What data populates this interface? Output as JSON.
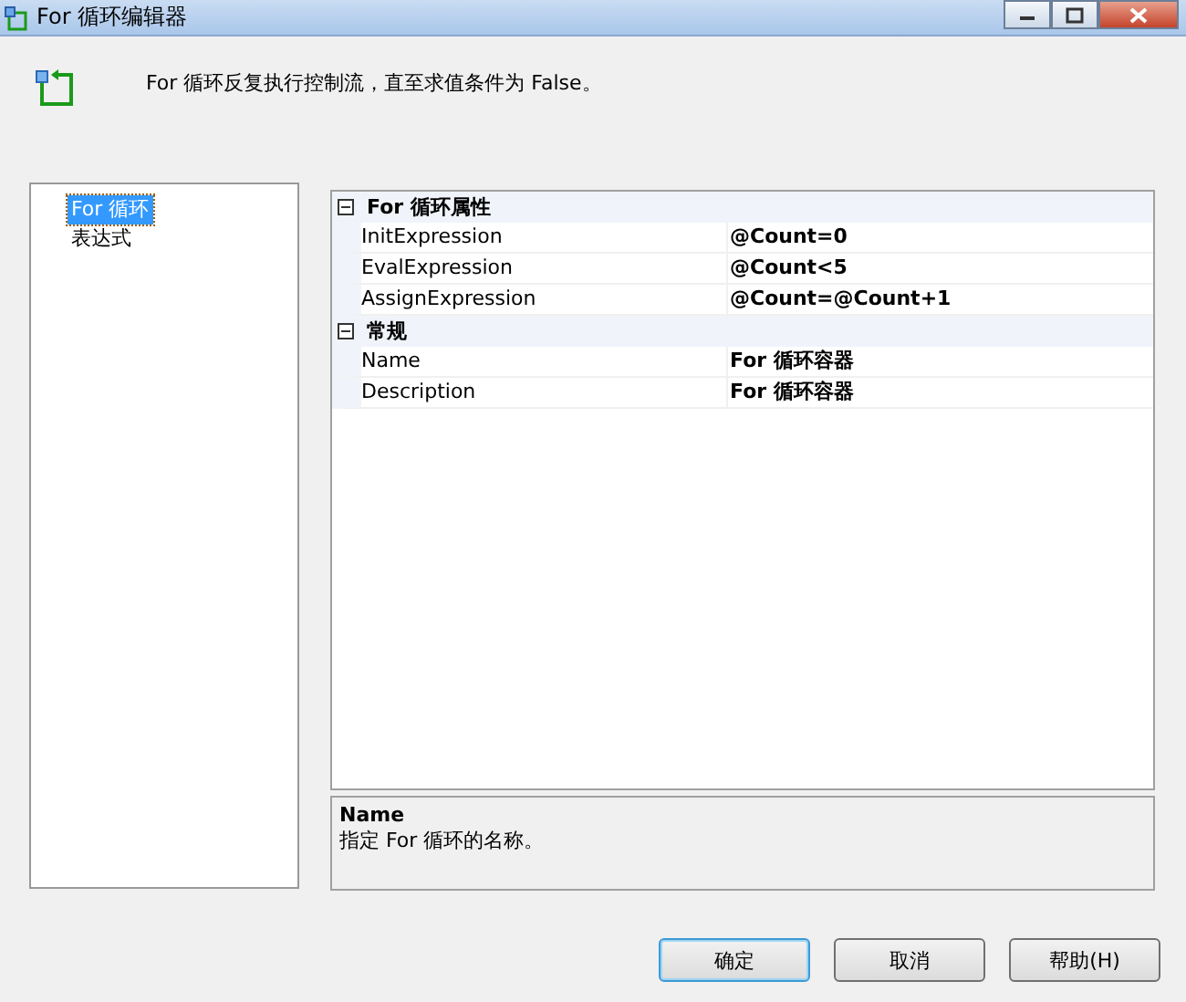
{
  "window": {
    "title": "For 循环编辑器"
  },
  "description": "For 循环反复执行控制流，直至求值条件为 False。",
  "nav": [
    {
      "label": "For 循环",
      "selected": true
    },
    {
      "label": "表达式",
      "selected": false
    }
  ],
  "grid": [
    {
      "label": "For 循环属性",
      "expanded": true,
      "properties": [
        {
          "name": "InitExpression",
          "value": "@Count=0"
        },
        {
          "name": "EvalExpression",
          "value": "@Count<5"
        },
        {
          "name": "AssignExpression",
          "value": "@Count=@Count+1"
        }
      ]
    },
    {
      "label": "常规",
      "expanded": true,
      "properties": [
        {
          "name": "Name",
          "value": "For 循环容器"
        },
        {
          "name": "Description",
          "value": "For 循环容器"
        }
      ]
    }
  ],
  "help": {
    "title": "Name",
    "text": "指定 For 循环的名称。"
  },
  "buttons": [
    {
      "label": "确定",
      "default": true
    },
    {
      "label": "取消",
      "default": false
    },
    {
      "label": "帮助(H)",
      "default": false
    }
  ]
}
